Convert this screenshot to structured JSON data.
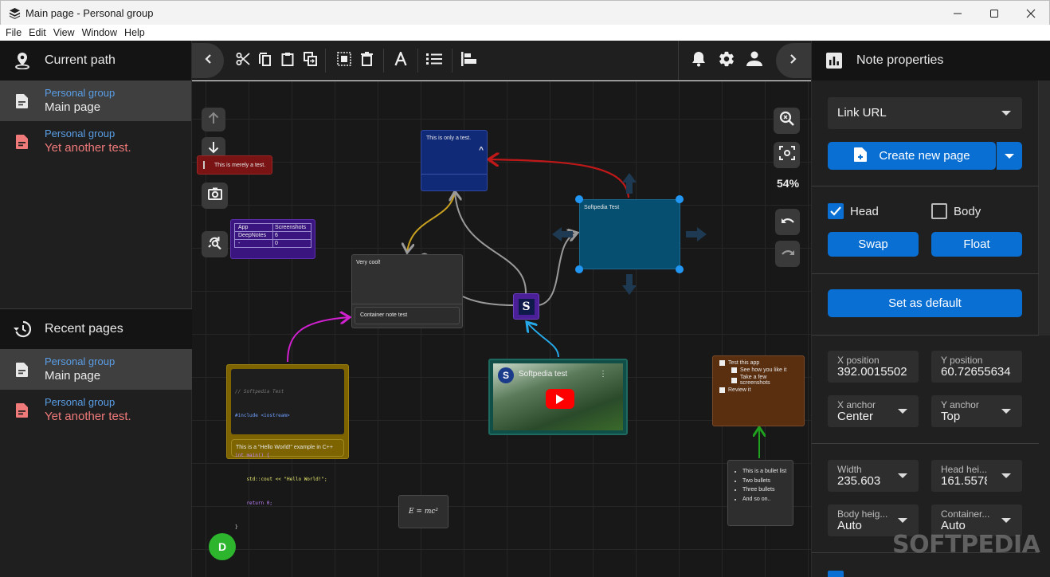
{
  "window": {
    "title": "Main page - Personal group",
    "controls": {
      "minimize": "—",
      "maximize": "☐",
      "close": "✕"
    }
  },
  "menu": [
    "File",
    "Edit",
    "View",
    "Window",
    "Help"
  ],
  "left_panel": {
    "current_path": {
      "title": "Current path",
      "items": [
        {
          "group": "Personal group",
          "name": "Main page",
          "selected": true
        },
        {
          "group": "Personal group",
          "name": "Yet another test.",
          "selected": false
        }
      ]
    },
    "recent_pages": {
      "title": "Recent pages",
      "items": [
        {
          "group": "Personal group",
          "name": "Main page",
          "selected": true
        },
        {
          "group": "Personal group",
          "name": "Yet another test.",
          "selected": false
        }
      ]
    }
  },
  "toolbar": {
    "left_icons": [
      "chevron-left",
      "cut",
      "copy",
      "paste",
      "duplicate",
      "select-all",
      "delete",
      "text-format",
      "numbered-list",
      "align-left"
    ],
    "right_icons": [
      "bell",
      "gear",
      "user",
      "chevron-right"
    ]
  },
  "canvas": {
    "zoom": "54%",
    "avatar_initial": "D",
    "notes": {
      "merely": "This is merely a test.",
      "only": "This is only a test.",
      "softpedia": "Softpedia Test",
      "very_cool": "Very cool!",
      "container": "Container note test",
      "table": {
        "headers": [
          "App",
          "Screenshots"
        ],
        "rows": [
          [
            "DeepNotes",
            "6"
          ],
          [
            "-",
            "0"
          ]
        ]
      },
      "code": {
        "lines": [
          "// Softpedia Test",
          "#include <iostream>",
          "",
          "int main() {",
          "    std::cout << \"Hello World!\";",
          "    return 0;",
          "}"
        ],
        "caption": "This is a \"Hello World!\" example in C++"
      },
      "video": {
        "title": "Softpedia test",
        "logo_letter": "S"
      },
      "s_node": "S",
      "todo": [
        {
          "text": "Test this app",
          "level": 0
        },
        {
          "text": "See how you like it",
          "level": 1
        },
        {
          "text": "Take a few screenshots",
          "level": 1
        },
        {
          "text": "Review it",
          "level": 0
        }
      ],
      "bullets": [
        "This is a bullet list",
        "Two bullets",
        "Three bullets",
        "And so on.."
      ],
      "formula": "E = mc²"
    }
  },
  "right_panel": {
    "title": "Note properties",
    "link_select": "Link URL",
    "create_page": "Create new page",
    "head_label": "Head",
    "head_checked": true,
    "body_label": "Body",
    "body_checked": false,
    "swap": "Swap",
    "float": "Float",
    "set_default": "Set as default",
    "fields": {
      "x_position": {
        "label": "X position",
        "value": "392.0015502"
      },
      "y_position": {
        "label": "Y position",
        "value": "60.72655634"
      },
      "x_anchor": {
        "label": "X anchor",
        "value": "Center"
      },
      "y_anchor": {
        "label": "Y anchor",
        "value": "Top"
      },
      "width": {
        "label": "Width",
        "value": "235.603"
      },
      "head_height": {
        "label": "Head hei...",
        "value": "161.5578"
      },
      "body_height": {
        "label": "Body heig...",
        "value": "Auto"
      },
      "container": {
        "label": "Container...",
        "value": "Auto"
      }
    },
    "colors": {
      "accent": "#0a6fd3"
    }
  },
  "watermark": "SOFTPEDIA"
}
